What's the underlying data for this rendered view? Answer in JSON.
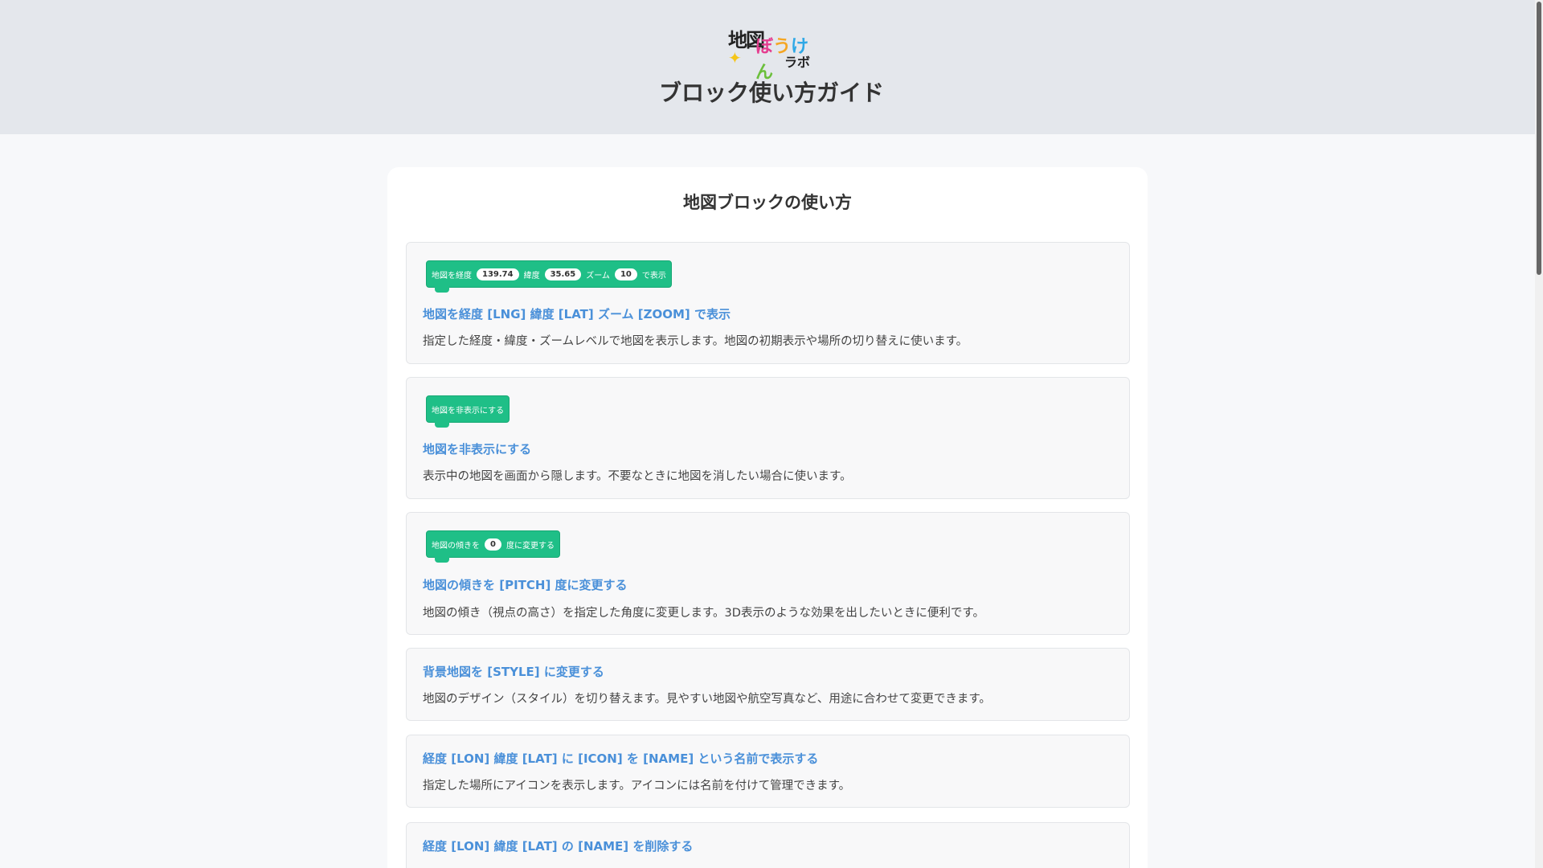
{
  "header": {
    "logo": {
      "line1": "地図",
      "line2": [
        "ぼ",
        "う",
        "け",
        "ん"
      ],
      "line3": "ラボ",
      "star": "✦"
    },
    "title": "ブロック使い方ガイド"
  },
  "section": {
    "title": "地図ブロックの使い方",
    "items": [
      {
        "block": {
          "parts": [
            "地図を経度",
            "139.74",
            "緯度",
            "35.65",
            "ズーム",
            "10",
            "で表示"
          ]
        },
        "name": "地図を経度 [LNG] 緯度 [LAT] ズーム [ZOOM] で表示",
        "desc": "指定した経度・緯度・ズームレベルで地図を表示します。地図の初期表示や場所の切り替えに使います。"
      },
      {
        "block": {
          "parts": [
            "地図を非表示にする"
          ]
        },
        "name": "地図を非表示にする",
        "desc": "表示中の地図を画面から隠します。不要なときに地図を消したい場合に使います。"
      },
      {
        "block": {
          "parts": [
            "地図の傾きを",
            "0",
            "度に変更する"
          ]
        },
        "name": "地図の傾きを [PITCH] 度に変更する",
        "desc": "地図の傾き（視点の高さ）を指定した角度に変更します。3D表示のような効果を出したいときに便利です。"
      },
      {
        "name": "背景地図を [STYLE] に変更する",
        "desc": "地図のデザイン（スタイル）を切り替えます。見やすい地図や航空写真など、用途に合わせて変更できます。"
      },
      {
        "name": "経度 [LON] 緯度 [LAT] に [ICON] を [NAME] という名前で表示する",
        "desc": "指定した場所にアイコンを表示します。アイコンには名前を付けて管理できます。"
      },
      {
        "name": "経度 [LON] 緯度 [LAT] の [NAME] を削除する"
      }
    ]
  }
}
